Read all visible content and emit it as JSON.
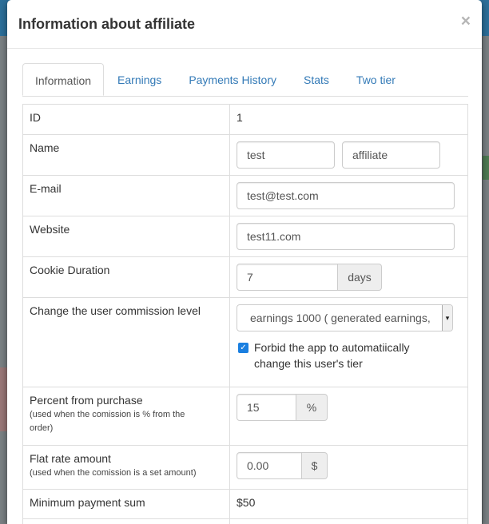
{
  "modal": {
    "title": "Information about affiliate",
    "close_glyph": "×"
  },
  "tabs": [
    {
      "label": "Information",
      "active": true
    },
    {
      "label": "Earnings",
      "active": false
    },
    {
      "label": "Payments History",
      "active": false
    },
    {
      "label": "Stats",
      "active": false
    },
    {
      "label": "Two tier",
      "active": false
    }
  ],
  "rows": {
    "id": {
      "label": "ID",
      "value": "1"
    },
    "name": {
      "label": "Name",
      "first": "test",
      "last": "affiliate"
    },
    "email": {
      "label": "E-mail",
      "value": "test@test.com"
    },
    "website": {
      "label": "Website",
      "value": "test11.com"
    },
    "cookie": {
      "label": "Cookie Duration",
      "value": "7",
      "addon": "days"
    },
    "commission": {
      "label": "Change the user commission level",
      "selected": "earnings 1000 ( generated earnings,",
      "checkbox_checked": true,
      "checkbox_line1": "Forbid the app to automatiically",
      "checkbox_line2": "change this user's tier"
    },
    "percent": {
      "label": "Percent from purchase",
      "note_line1": "(used when the comission is % from the",
      "note_line2": "order)",
      "value": "15",
      "addon": "%"
    },
    "flat": {
      "label": "Flat rate amount",
      "note": "(used when the comission is a set amount)",
      "value": "0.00",
      "addon": "$"
    },
    "min_payment": {
      "label": "Minimum payment sum",
      "value": "$50"
    }
  },
  "colors": {
    "accent": "#337ab7",
    "checkbox": "#1a7fe0"
  }
}
